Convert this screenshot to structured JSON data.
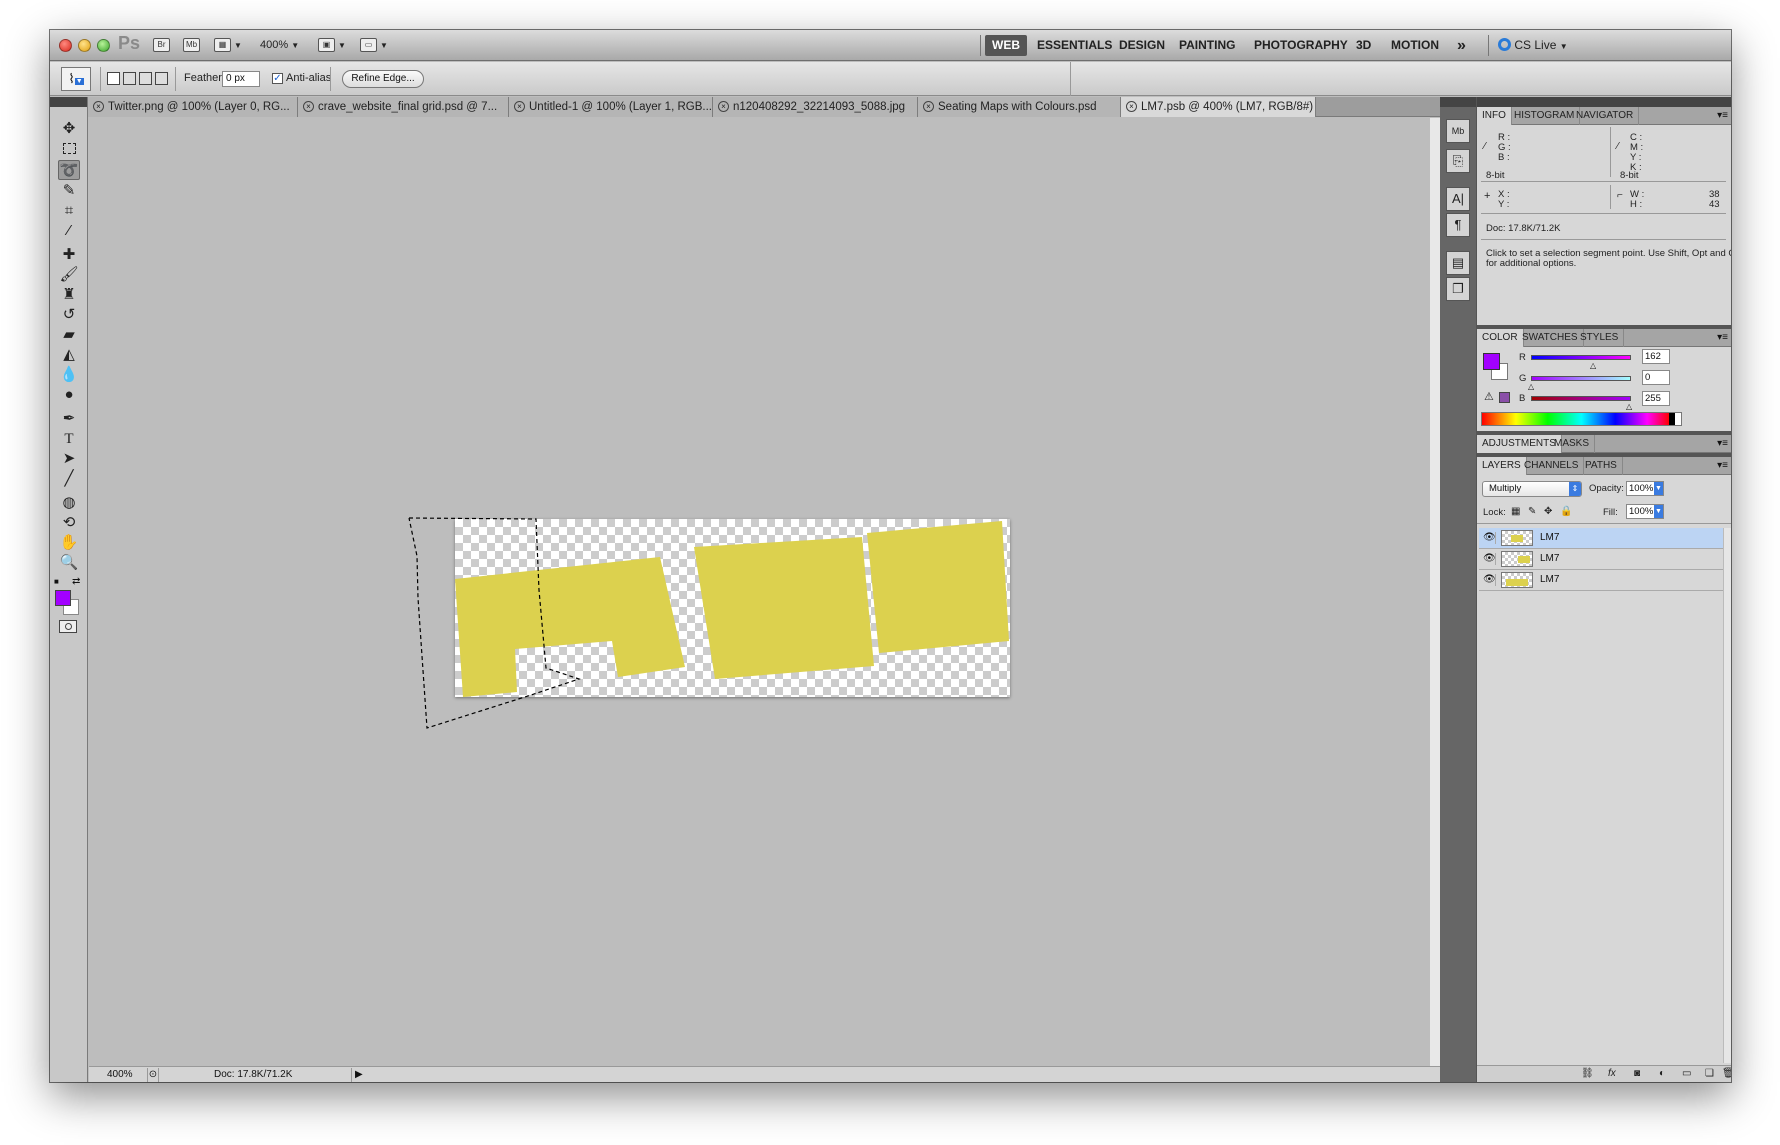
{
  "appbar": {
    "logo": "Ps",
    "bridge": "Br",
    "minibridge": "Mb",
    "zoom": "400%",
    "workspaces": [
      "WEB",
      "ESSENTIALS",
      "DESIGN",
      "PAINTING",
      "PHOTOGRAPHY",
      "3D",
      "MOTION"
    ],
    "active_workspace": "WEB",
    "more": "»",
    "cs_live": "CS Live"
  },
  "options": {
    "feather_label": "Feather:",
    "feather_value": "0 px",
    "antialias_label": "Anti-alias",
    "antialias_checked": true,
    "refine_edge": "Refine Edge..."
  },
  "tabs": [
    "Twitter.png @ 100% (Layer 0, RG...",
    "crave_website_final grid.psd @ 7...",
    "Untitled-1 @ 100% (Layer 1, RGB...",
    "n120408292_32214093_5088.jpg",
    "Seating Maps with Colours.psd",
    "LM7.psb @ 400% (LM7, RGB/8#)"
  ],
  "active_tab_index": 5,
  "status": {
    "zoom": "400%",
    "doc": "Doc: 17.8K/71.2K"
  },
  "info_panel": {
    "tabs": [
      "INFO",
      "HISTOGRAM",
      "NAVIGATOR"
    ],
    "rgb_labels": [
      "R :",
      "G :",
      "B :"
    ],
    "cmyk_labels": [
      "C :",
      "M :",
      "Y :",
      "K :"
    ],
    "bitdepth_left": "8-bit",
    "bitdepth_right": "8-bit",
    "xy_labels": [
      "X :",
      "Y :"
    ],
    "wh_labels": [
      "W :",
      "H :"
    ],
    "w_value": "38",
    "h_value": "43",
    "doc": "Doc: 17.8K/71.2K",
    "hint_line1": "Click to set a selection segment point.  Use Shift, Opt and Cmd",
    "hint_line2": "for additional options."
  },
  "color_panel": {
    "tabs": [
      "COLOR",
      "SWATCHES",
      "STYLES"
    ],
    "r_label": "R",
    "g_label": "G",
    "b_label": "B",
    "r": "162",
    "g": "0",
    "b": "255",
    "foreground": "#a200ff"
  },
  "adjustments_panel": {
    "tabs": [
      "ADJUSTMENTS",
      "MASKS"
    ]
  },
  "layers_panel": {
    "tabs": [
      "LAYERS",
      "CHANNELS",
      "PATHS"
    ],
    "blend_mode": "Multiply",
    "opacity_label": "Opacity:",
    "opacity": "100%",
    "lock_label": "Lock:",
    "fill_label": "Fill:",
    "fill": "100%",
    "layers": [
      {
        "name": "LM7",
        "selected": true
      },
      {
        "name": "LM7",
        "selected": false
      },
      {
        "name": "LM7",
        "selected": false
      }
    ]
  },
  "colors": {
    "shape_yellow": "#dcd14e",
    "foreground": "#a200ff",
    "selected_layer": "#bcd4f3"
  }
}
